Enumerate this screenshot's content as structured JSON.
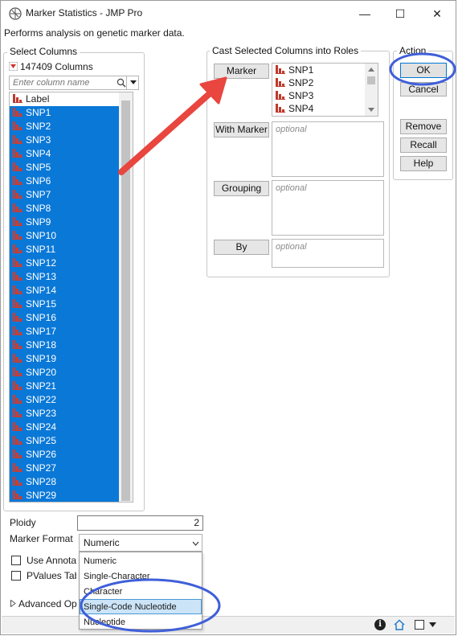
{
  "window": {
    "title": "Marker Statistics - JMP Pro",
    "minimize": "—",
    "maximize": "☐",
    "close": "✕"
  },
  "description": "Performs analysis on genetic marker data.",
  "select_columns": {
    "heading": "Select Columns",
    "count": "147409 Columns",
    "search_placeholder": "Enter column name",
    "items": [
      "Label",
      "SNP1",
      "SNP2",
      "SNP3",
      "SNP4",
      "SNP5",
      "SNP6",
      "SNP7",
      "SNP8",
      "SNP9",
      "SNP10",
      "SNP11",
      "SNP12",
      "SNP13",
      "SNP14",
      "SNP15",
      "SNP16",
      "SNP17",
      "SNP18",
      "SNP19",
      "SNP20",
      "SNP21",
      "SNP22",
      "SNP23",
      "SNP24",
      "SNP25",
      "SNP26",
      "SNP27",
      "SNP28",
      "SNP29"
    ]
  },
  "cast": {
    "heading": "Cast Selected Columns into Roles",
    "marker": {
      "label": "Marker",
      "items": [
        "SNP1",
        "SNP2",
        "SNP3",
        "SNP4"
      ]
    },
    "with_marker": {
      "label": "With Marker",
      "placeholder": "optional"
    },
    "grouping": {
      "label": "Grouping",
      "placeholder": "optional"
    },
    "by": {
      "label": "By",
      "placeholder": "optional"
    }
  },
  "action": {
    "heading": "Action",
    "ok": "OK",
    "cancel": "Cancel",
    "remove": "Remove",
    "recall": "Recall",
    "help": "Help"
  },
  "options": {
    "ploidy_label": "Ploidy",
    "ploidy_value": "2",
    "marker_format_label": "Marker Format",
    "marker_format_value": "Numeric",
    "use_annotation": "Use Annotat",
    "pvalues_table": "PValues Tabl",
    "advanced": "Advanced Op"
  },
  "dropdown": {
    "options": [
      "Numeric",
      "Single-Character",
      "Character",
      "Single-Code Nucleotide",
      "Nucleotide"
    ],
    "highlighted": "Single-Code Nucleotide"
  },
  "colors": {
    "selection": "#0a78d7",
    "annotation_blue": "#3f5fd9",
    "annotation_red": "#e8463f",
    "column_icon": "#c0392b"
  }
}
